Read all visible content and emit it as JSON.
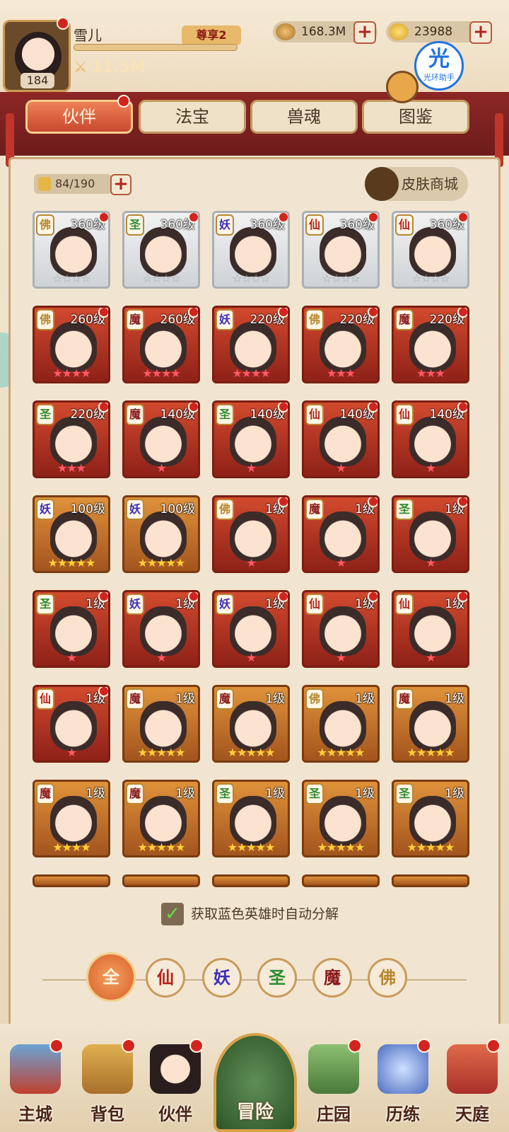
{
  "player": {
    "name": "雪儿",
    "level": "184",
    "vip": "尊享2",
    "power": "11.5M"
  },
  "currency": {
    "coins": "168.3M",
    "gold": "23988"
  },
  "assistant": {
    "big": "光",
    "small": "光环助手"
  },
  "tabs": [
    {
      "label": "伙伴"
    },
    {
      "label": "法宝"
    },
    {
      "label": "兽魂"
    },
    {
      "label": "图鉴"
    }
  ],
  "roster": {
    "count": "84/190",
    "skin_shop": "皮肤商城"
  },
  "heroes": [
    {
      "faction": "佛",
      "level": "360级",
      "stars": "☆☆☆☆",
      "tier": "silver"
    },
    {
      "faction": "圣",
      "level": "360级",
      "stars": "☆☆☆☆",
      "tier": "silver"
    },
    {
      "faction": "妖",
      "level": "360级",
      "stars": "☆☆☆☆",
      "tier": "silver"
    },
    {
      "faction": "仙",
      "level": "360级",
      "stars": "☆☆☆☆",
      "tier": "silver"
    },
    {
      "faction": "仙",
      "level": "360级",
      "stars": "☆☆☆☆",
      "tier": "silver"
    },
    {
      "faction": "佛",
      "level": "260级",
      "stars": "★★★★",
      "tier": "red"
    },
    {
      "faction": "魔",
      "level": "260级",
      "stars": "★★★★",
      "tier": "red"
    },
    {
      "faction": "妖",
      "level": "220级",
      "stars": "★★★★",
      "tier": "red"
    },
    {
      "faction": "佛",
      "level": "220级",
      "stars": "★★★",
      "tier": "red"
    },
    {
      "faction": "魔",
      "level": "220级",
      "stars": "★★★",
      "tier": "red"
    },
    {
      "faction": "圣",
      "level": "220级",
      "stars": "★★★",
      "tier": "red"
    },
    {
      "faction": "魔",
      "level": "140级",
      "stars": "★",
      "tier": "red"
    },
    {
      "faction": "圣",
      "level": "140级",
      "stars": "★",
      "tier": "red"
    },
    {
      "faction": "仙",
      "level": "140级",
      "stars": "★",
      "tier": "red"
    },
    {
      "faction": "仙",
      "level": "140级",
      "stars": "★",
      "tier": "red"
    },
    {
      "faction": "妖",
      "level": "100级",
      "stars": "★★★★★",
      "tier": "gold"
    },
    {
      "faction": "妖",
      "level": "100级",
      "stars": "★★★★★",
      "tier": "gold"
    },
    {
      "faction": "佛",
      "level": "1级",
      "stars": "★",
      "tier": "red"
    },
    {
      "faction": "魔",
      "level": "1级",
      "stars": "★",
      "tier": "red"
    },
    {
      "faction": "圣",
      "level": "1级",
      "stars": "★",
      "tier": "red"
    },
    {
      "faction": "圣",
      "level": "1级",
      "stars": "★",
      "tier": "red"
    },
    {
      "faction": "妖",
      "level": "1级",
      "stars": "★",
      "tier": "red"
    },
    {
      "faction": "妖",
      "level": "1级",
      "stars": "★",
      "tier": "red"
    },
    {
      "faction": "仙",
      "level": "1级",
      "stars": "★",
      "tier": "red"
    },
    {
      "faction": "仙",
      "level": "1级",
      "stars": "★",
      "tier": "red"
    },
    {
      "faction": "仙",
      "level": "1级",
      "stars": "★",
      "tier": "red"
    },
    {
      "faction": "魔",
      "level": "1级",
      "stars": "★★★★★",
      "tier": "gold"
    },
    {
      "faction": "魔",
      "level": "1级",
      "stars": "★★★★★",
      "tier": "gold"
    },
    {
      "faction": "佛",
      "level": "1级",
      "stars": "★★★★★",
      "tier": "gold"
    },
    {
      "faction": "魔",
      "level": "1级",
      "stars": "★★★★★",
      "tier": "gold"
    },
    {
      "faction": "魔",
      "level": "1级",
      "stars": "★★★★",
      "tier": "gold"
    },
    {
      "faction": "魔",
      "level": "1级",
      "stars": "★★★★★",
      "tier": "gold"
    },
    {
      "faction": "圣",
      "level": "1级",
      "stars": "★★★★★",
      "tier": "gold"
    },
    {
      "faction": "圣",
      "level": "1级",
      "stars": "★★★★★",
      "tier": "gold"
    },
    {
      "faction": "圣",
      "level": "1级",
      "stars": "★★★★★",
      "tier": "gold"
    }
  ],
  "auto_decompose": {
    "label": "获取蓝色英雄时自动分解",
    "checked": true
  },
  "filters": [
    {
      "label": "全",
      "color": "#ffffff"
    },
    {
      "label": "仙",
      "color": "#b3231c"
    },
    {
      "label": "妖",
      "color": "#3b2db8"
    },
    {
      "label": "圣",
      "color": "#2e8b2e"
    },
    {
      "label": "魔",
      "color": "#8b1a1a"
    },
    {
      "label": "佛",
      "color": "#b8872f"
    }
  ],
  "nav": [
    {
      "label": "主城"
    },
    {
      "label": "背包"
    },
    {
      "label": "伙伴"
    },
    {
      "label": "冒险"
    },
    {
      "label": "庄园"
    },
    {
      "label": "历练"
    },
    {
      "label": "天庭"
    }
  ]
}
